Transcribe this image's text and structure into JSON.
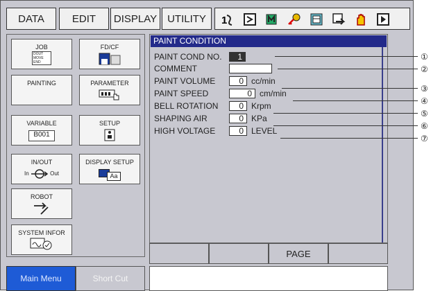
{
  "menubar": {
    "data": "DATA",
    "edit": "EDIT",
    "display": "DISPLAY",
    "utility": "UTILITY",
    "icons": [
      "servo-icon",
      "frame-icon",
      "tool-icon",
      "key-icon",
      "calendar-icon",
      "display-icon",
      "hand-icon",
      "play-icon"
    ]
  },
  "menu": {
    "job": "JOB",
    "job_sub": [
      "DOUT",
      "MOVE",
      "END"
    ],
    "fdcf": "FD/CF",
    "painting": "PAINTING",
    "parameter": "PARAMETER",
    "variable": "VARIABLE",
    "variable_value": "B001",
    "setup": "SETUP",
    "inout": "IN/OUT",
    "in_label": "In",
    "out_label": "Out",
    "display_setup": "DISPLAY SETUP",
    "display_setup_sub": "Aa",
    "robot": "ROBOT",
    "system_info": "SYSTEM INFOR"
  },
  "panel": {
    "title": "PAINT CONDITION",
    "rows": [
      {
        "label": "PAINT COND NO.",
        "value": "1",
        "unit": ""
      },
      {
        "label": "COMMENT",
        "value": "",
        "unit": ""
      },
      {
        "label": "PAINT VOLUME",
        "value": "0",
        "unit": "cc/min"
      },
      {
        "label": "PAINT SPEED",
        "value": "0",
        "unit": "cm/min"
      },
      {
        "label": "BELL ROTATION",
        "value": "0",
        "unit": "Krpm"
      },
      {
        "label": "SHAPING AIR",
        "value": "0",
        "unit": "KPa"
      },
      {
        "label": "HIGH VOLTAGE",
        "value": "0",
        "unit": "LEVEL"
      }
    ]
  },
  "callouts": [
    "①",
    "②",
    "③",
    "④",
    "⑤",
    "⑥",
    "⑦"
  ],
  "fnbar": {
    "b1": "",
    "b2": "",
    "b3": "PAGE",
    "b4": ""
  },
  "bottom": {
    "main_menu": "Main Menu",
    "short_cut": "Short Cut"
  },
  "colors": {
    "title_bar": "#232a8a",
    "main_menu": "#1e5bd6",
    "panel_bg": "#c8c8d0"
  }
}
